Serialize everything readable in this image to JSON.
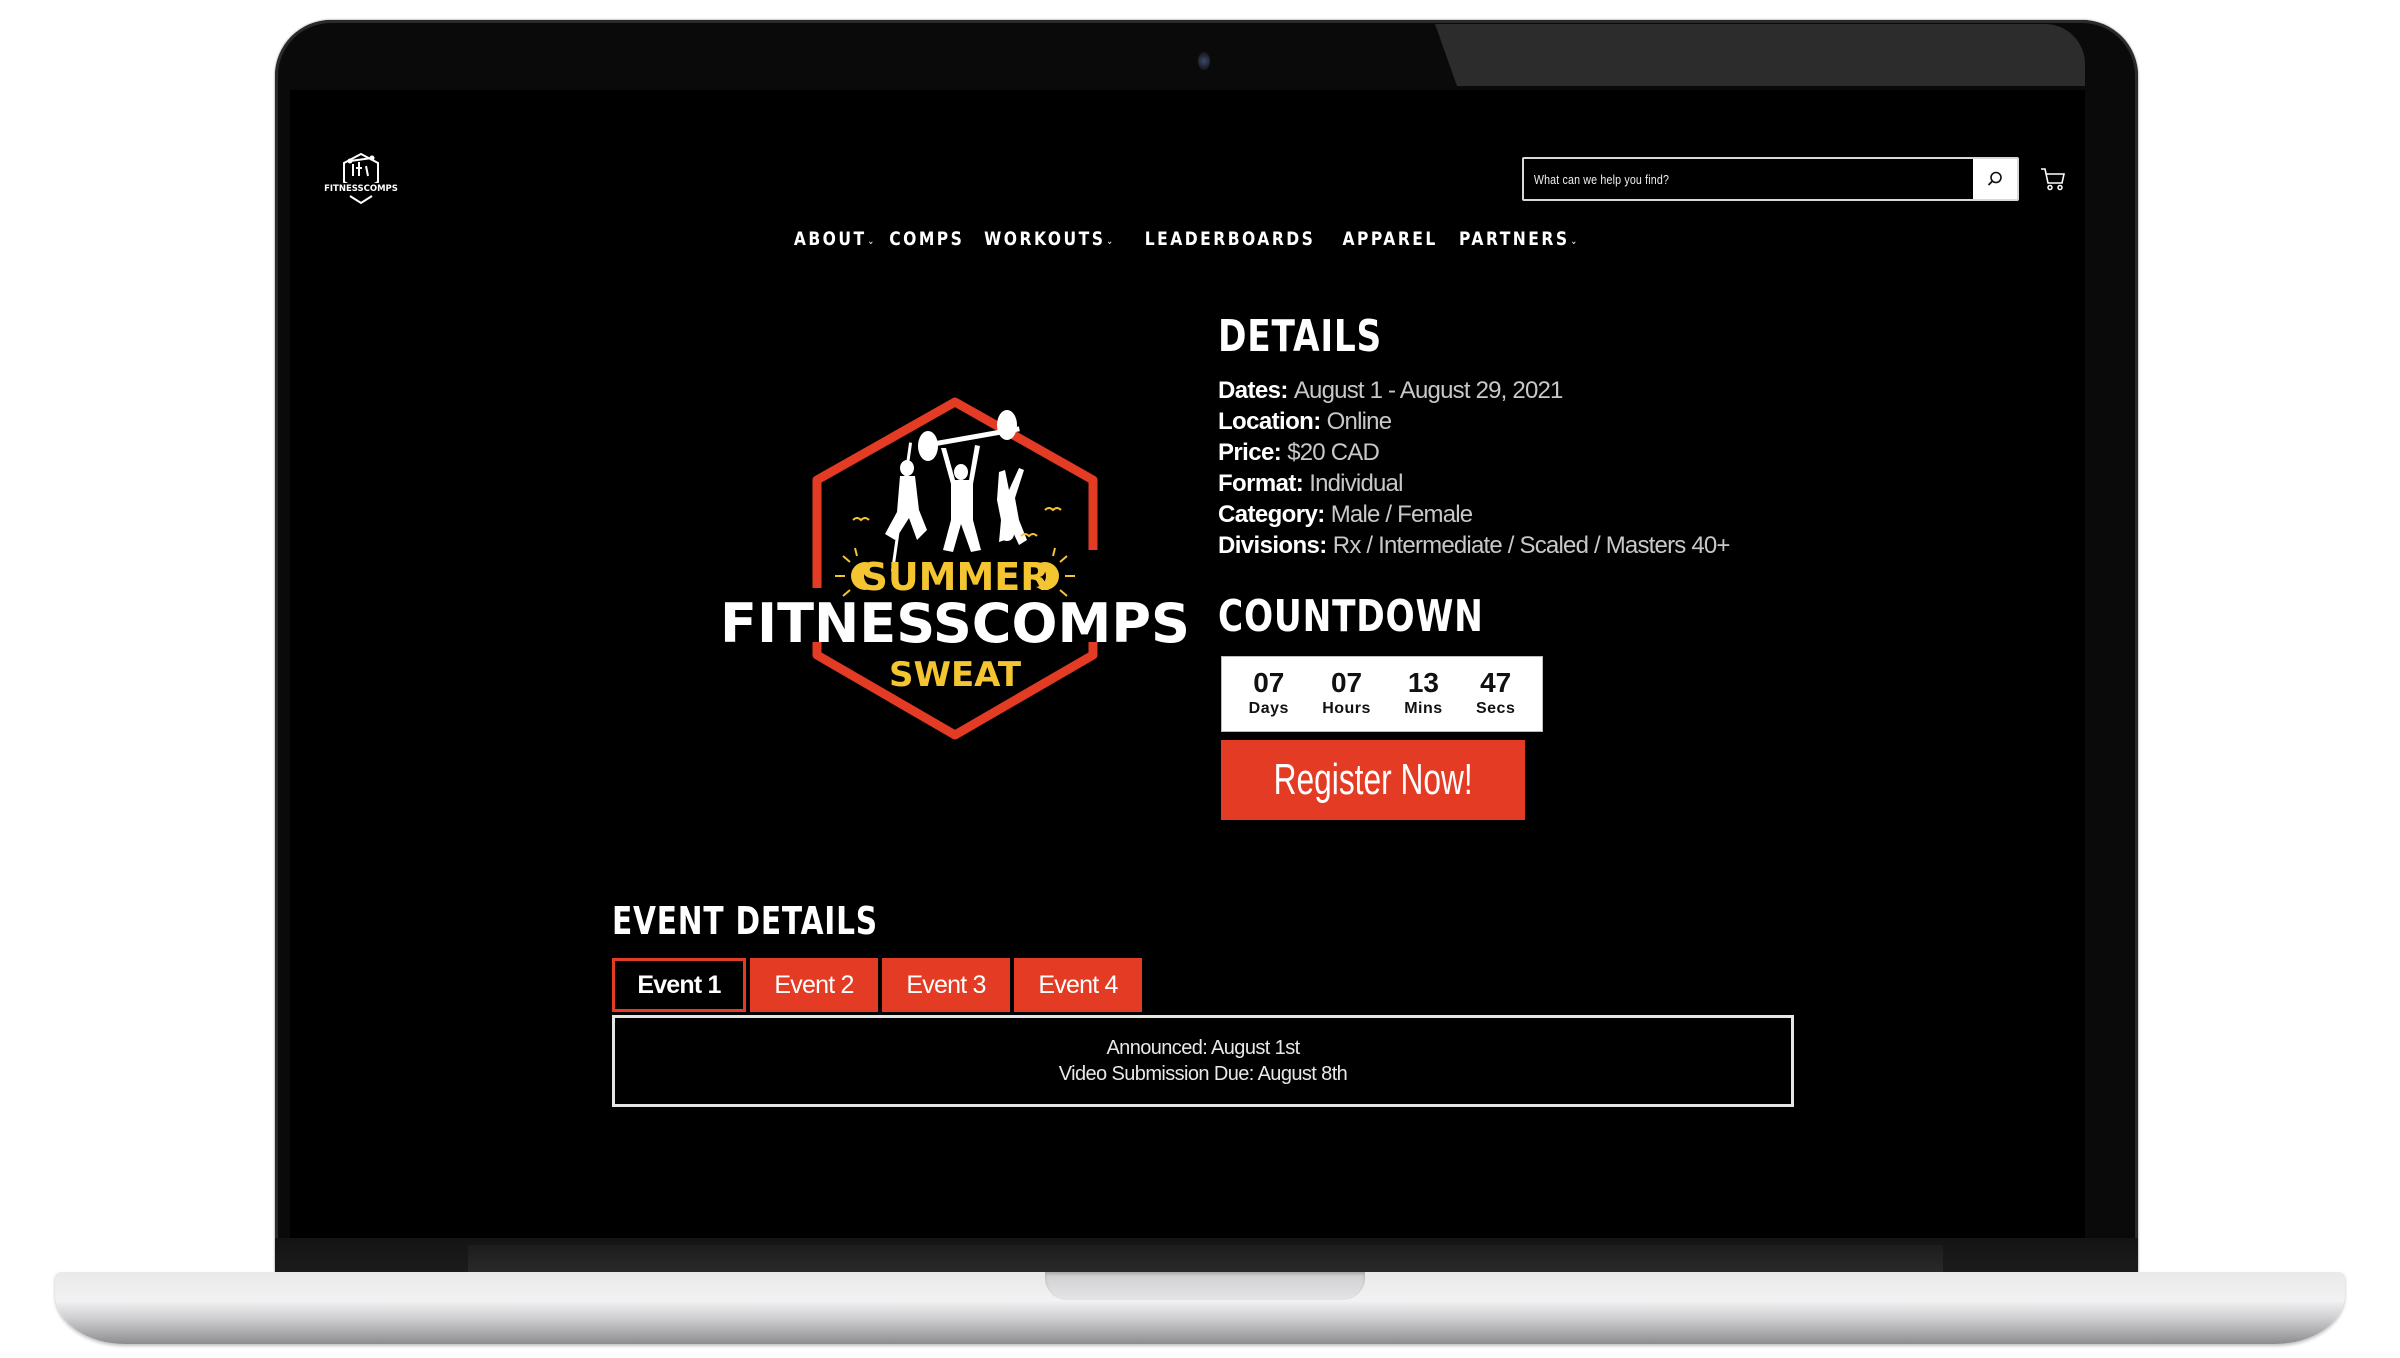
{
  "header": {
    "site_logo_text": "FITNESSCOMPS",
    "search": {
      "placeholder": "What can we help you find?",
      "value": ""
    },
    "icons": {
      "search": "search-icon",
      "cart": "cart-icon"
    }
  },
  "nav": {
    "items": [
      {
        "label": "ABOUT",
        "has_dropdown": true
      },
      {
        "label": "COMPS",
        "has_dropdown": false
      },
      {
        "label": "WORKOUTS",
        "has_dropdown": true
      },
      {
        "label": "LEADERBOARDS",
        "has_dropdown": false
      },
      {
        "label": "APPAREL",
        "has_dropdown": false
      },
      {
        "label": "PARTNERS",
        "has_dropdown": true
      }
    ],
    "caret": "⌄"
  },
  "event_logo": {
    "line1": "SUMMER",
    "line2": "FITNESSCOMPS",
    "line3": "SWEAT"
  },
  "details": {
    "title": "DETAILS",
    "rows": [
      {
        "key": "Dates:",
        "value": "August 1 - August 29, 2021"
      },
      {
        "key": "Location:",
        "value": "Online"
      },
      {
        "key": "Price:",
        "value": "$20 CAD"
      },
      {
        "key": "Format:",
        "value": "Individual"
      },
      {
        "key": "Category:",
        "value": "Male / Female"
      },
      {
        "key": "Divisions:",
        "value": "Rx / Intermediate / Scaled / Masters 40+"
      }
    ]
  },
  "countdown": {
    "title": "COUNTDOWN",
    "units": [
      {
        "value": "07",
        "label": "Days"
      },
      {
        "value": "07",
        "label": "Hours"
      },
      {
        "value": "13",
        "label": "Mins"
      },
      {
        "value": "47",
        "label": "Secs"
      }
    ]
  },
  "register": {
    "label": "Register Now!"
  },
  "event_details": {
    "title": "EVENT DETAILS",
    "tabs": [
      {
        "label": "Event 1",
        "active": true
      },
      {
        "label": "Event 2",
        "active": false
      },
      {
        "label": "Event 3",
        "active": false
      },
      {
        "label": "Event 4",
        "active": false
      }
    ],
    "panel": {
      "line1": "Announced: August 1st",
      "line2": "Video Submission Due: August 8th"
    }
  },
  "colors": {
    "accent_red": "#e33b24",
    "accent_yellow": "#f4c531",
    "background": "#000000",
    "text": "#ffffff"
  }
}
